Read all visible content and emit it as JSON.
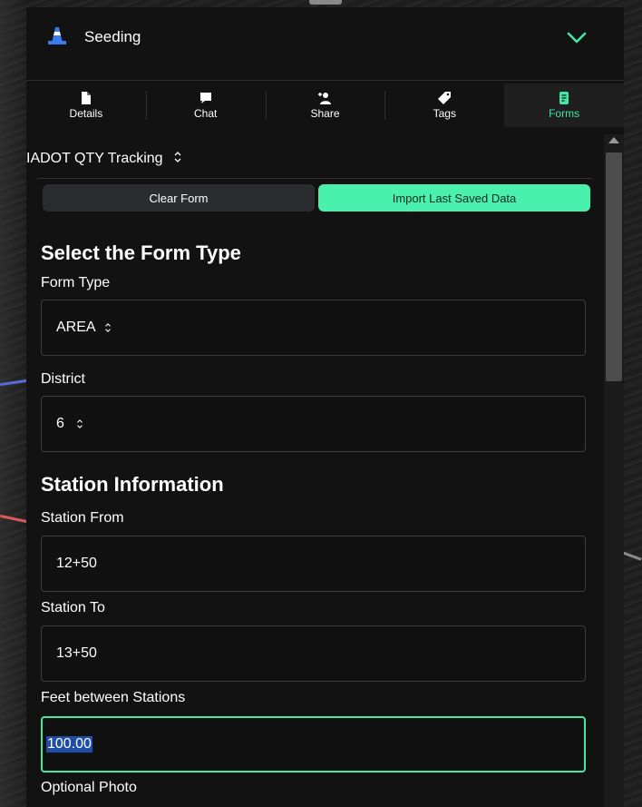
{
  "header": {
    "title": "Seeding",
    "icon": "traffic-cone-icon",
    "accent": "#43e8a5"
  },
  "tabs": [
    {
      "label": "Details",
      "icon": "document-icon",
      "active": false
    },
    {
      "label": "Chat",
      "icon": "chat-bubble-icon",
      "active": false
    },
    {
      "label": "Share",
      "icon": "add-user-icon",
      "active": false
    },
    {
      "label": "Tags",
      "icon": "tag-icon",
      "active": false
    },
    {
      "label": "Forms",
      "icon": "form-icon",
      "active": true
    }
  ],
  "form": {
    "selector_label": "IADOT QTY Tracking",
    "clear_label": "Clear Form",
    "import_label": "Import Last Saved Data",
    "section1_title": "Select the Form Type",
    "form_type_label": "Form Type",
    "form_type_value": "AREA",
    "district_label": "District",
    "district_value": "6",
    "section2_title": "Station Information",
    "station_from_label": "Station From",
    "station_from_value": "12+50",
    "station_to_label": "Station To",
    "station_to_value": "13+50",
    "feet_label": "Feet between Stations",
    "feet_value": "100.00",
    "photo_label": "Optional Photo"
  },
  "colors": {
    "import_button": "#4af0ae",
    "active_tab": "#43e8a5",
    "selection": "#1f4ea8"
  }
}
